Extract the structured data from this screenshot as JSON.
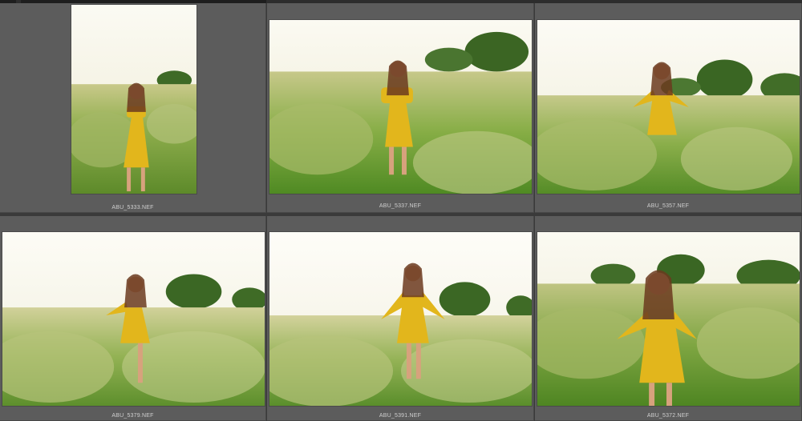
{
  "thumbnails": [
    {
      "filename": "ABU_5333.NEF",
      "orientation": "portrait"
    },
    {
      "filename": "ABU_5337.NEF",
      "orientation": "landscape"
    },
    {
      "filename": "ABU_5357.NEF",
      "orientation": "landscape"
    },
    {
      "filename": "ABU_5379.NEF",
      "orientation": "landscape"
    },
    {
      "filename": "ABU_5391.NEF",
      "orientation": "landscape"
    },
    {
      "filename": "ABU_5372.NEF",
      "orientation": "landscape"
    }
  ],
  "colors": {
    "cell_bg": "#5c5c5c",
    "sky": "#f4f2e6",
    "grass": "#7aa83a",
    "dress": "#e0b419",
    "trees": "#3f6a24"
  }
}
